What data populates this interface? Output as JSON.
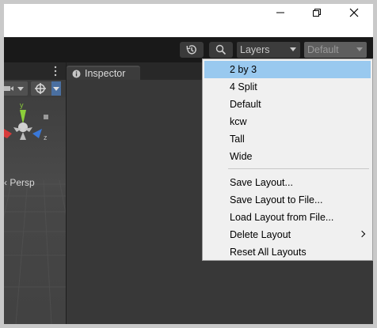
{
  "window": {
    "minimize_icon": "minimize-icon",
    "restore_icon": "restore-icon",
    "close_icon": "close-icon"
  },
  "toolbar": {
    "history_icon": "history-icon",
    "search_icon": "search-icon",
    "layers_label": "Layers",
    "layout_label": "Default"
  },
  "scene": {
    "persp_label": "‹ Persp",
    "axis_y": "y",
    "axis_z": "z"
  },
  "inspector": {
    "tab_label": "Inspector"
  },
  "layout_menu": {
    "items": [
      {
        "label": "2 by 3",
        "selected": true
      },
      {
        "label": "4 Split"
      },
      {
        "label": "Default"
      },
      {
        "label": "kcw"
      },
      {
        "label": "Tall"
      },
      {
        "label": "Wide"
      }
    ],
    "actions": [
      {
        "label": "Save Layout..."
      },
      {
        "label": "Save Layout to File..."
      },
      {
        "label": "Load Layout from File..."
      },
      {
        "label": "Delete Layout",
        "submenu": true
      },
      {
        "label": "Reset All Layouts"
      }
    ]
  },
  "colors": {
    "menu_highlight": "#99c9ef",
    "editor_dark": "#282828",
    "panel": "#383838",
    "gizmo_y": "#8ccf3a",
    "gizmo_x": "#d83a3a",
    "gizmo_z": "#3a78d8"
  }
}
